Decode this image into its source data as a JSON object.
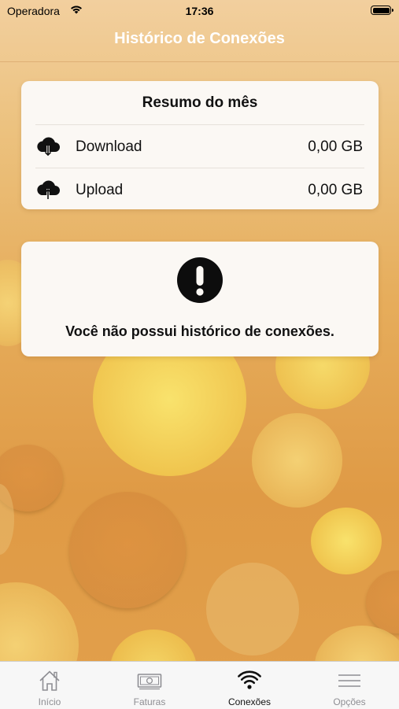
{
  "status_bar": {
    "carrier": "Operadora",
    "time": "17:36"
  },
  "nav": {
    "title": "Histórico de Conexões"
  },
  "summary": {
    "title": "Resumo do mês",
    "rows": [
      {
        "label": "Download",
        "value": "0,00 GB",
        "icon": "cloud-download-icon"
      },
      {
        "label": "Upload",
        "value": "0,00 GB",
        "icon": "cloud-upload-icon"
      }
    ]
  },
  "empty_state": {
    "icon": "exclamation-circle-icon",
    "message": "Você não possui histórico de conexões."
  },
  "tabs": [
    {
      "label": "Início",
      "icon": "home-icon",
      "active": false
    },
    {
      "label": "Faturas",
      "icon": "banknote-icon",
      "active": false
    },
    {
      "label": "Conexões",
      "icon": "wifi-icon",
      "active": true
    },
    {
      "label": "Opções",
      "icon": "menu-icon",
      "active": false
    }
  ],
  "colors": {
    "background": "#e0a24e",
    "card": "#fbf8f4",
    "tab_active": "#111111",
    "tab_inactive": "#8e8e93"
  }
}
